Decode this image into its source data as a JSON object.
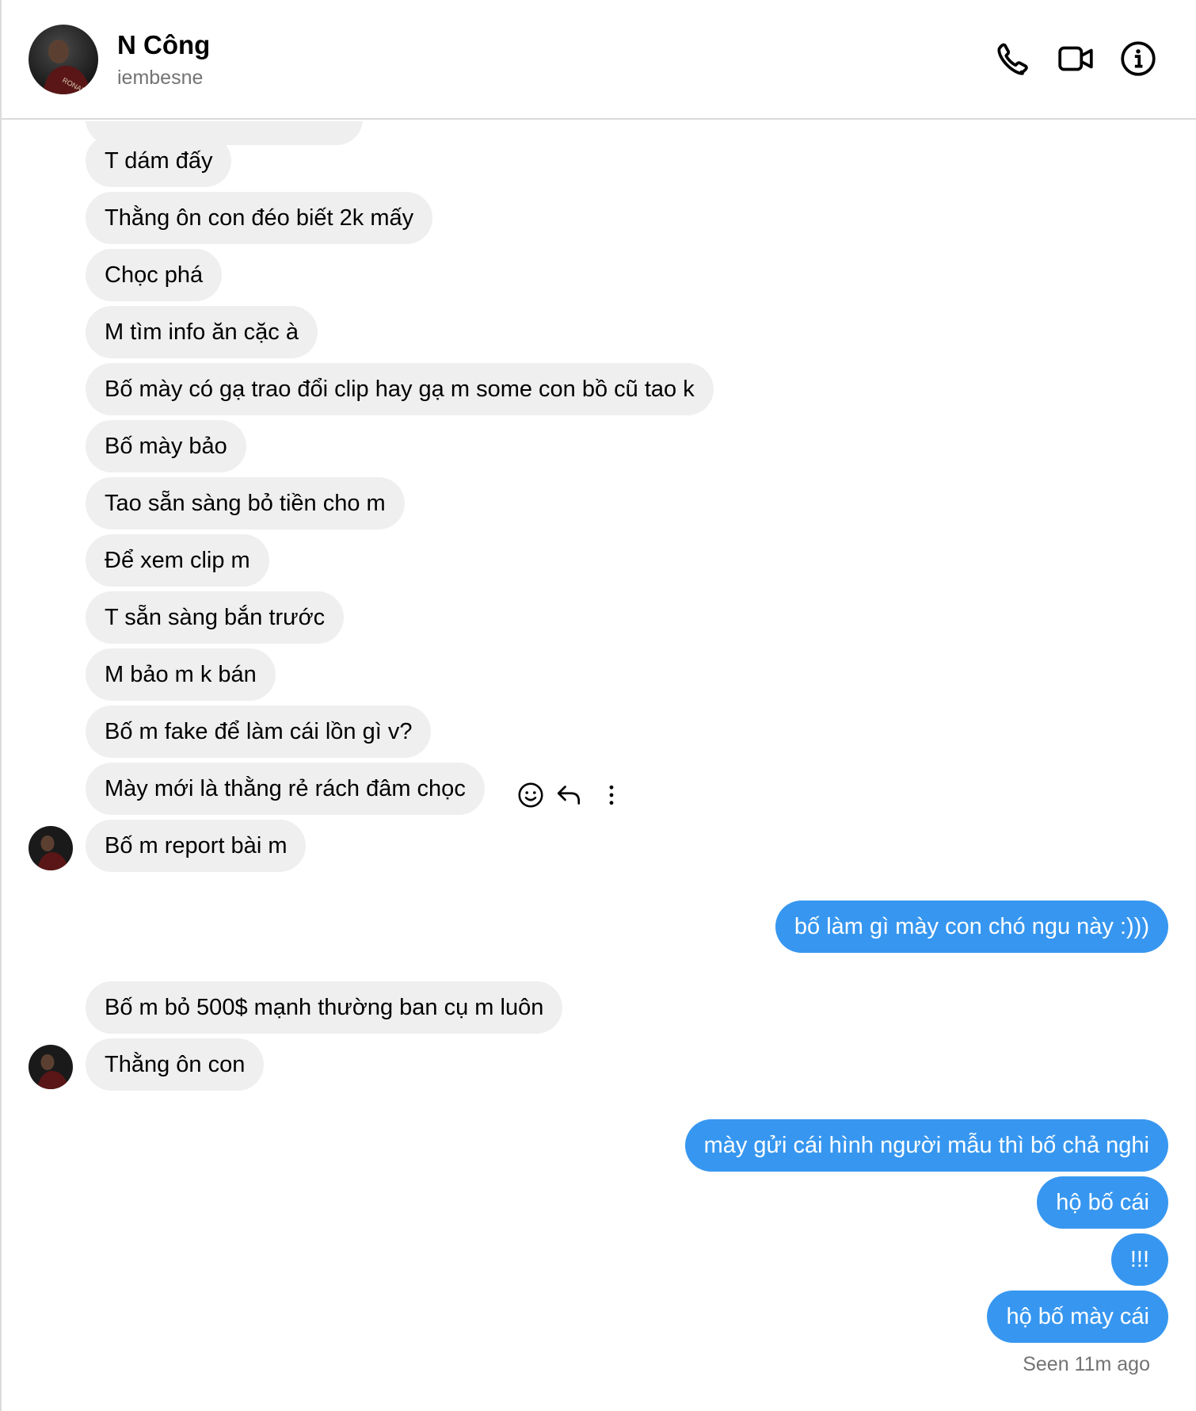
{
  "header": {
    "name": "N Công",
    "username": "iembesne",
    "avatar_icon": "profile-photo",
    "buttons": [
      {
        "name": "call-button",
        "icon": "phone-icon"
      },
      {
        "name": "video-call-button",
        "icon": "video-icon"
      },
      {
        "name": "info-button",
        "icon": "info-icon"
      }
    ]
  },
  "messages": {
    "m1": "T dám đấy",
    "m2": "Thằng ôn con đéo biết 2k mấy",
    "m3": "Chọc phá",
    "m4": "M tìm info ăn cặc à",
    "m5": "Bố mày có gạ trao đổi clip hay gạ m some con bồ cũ tao k",
    "m6": "Bố mày bảo",
    "m7": "Tao sẵn sàng bỏ tiền cho m",
    "m8": "Để xem clip m",
    "m9": "T sẵn sàng bắn trước",
    "m10": "M bảo m k bán",
    "m11": "Bố m fake để làm cái lồn gì v?",
    "m12": "Mày mới là thằng rẻ rách đâm chọc",
    "m13": "Bố m report bài m",
    "o1": "bố làm gì mày con chó ngu này :)))",
    "m14": "Bố m bỏ 500$ mạnh thường ban cụ m luôn",
    "m15": "Thằng ôn con",
    "o2": "mày gửi cái hình người mẫu thì bố chả nghi",
    "o3": "hộ bố cái",
    "o4": "!!!",
    "o5": "hộ bố mày cái"
  },
  "message_actions": [
    "react-icon",
    "reply-icon",
    "more-icon"
  ],
  "seen_status": "Seen 11m ago",
  "colors": {
    "incoming_bubble": "#efefef",
    "outgoing_bubble": "#3797f0",
    "secondary_text": "#737373"
  }
}
